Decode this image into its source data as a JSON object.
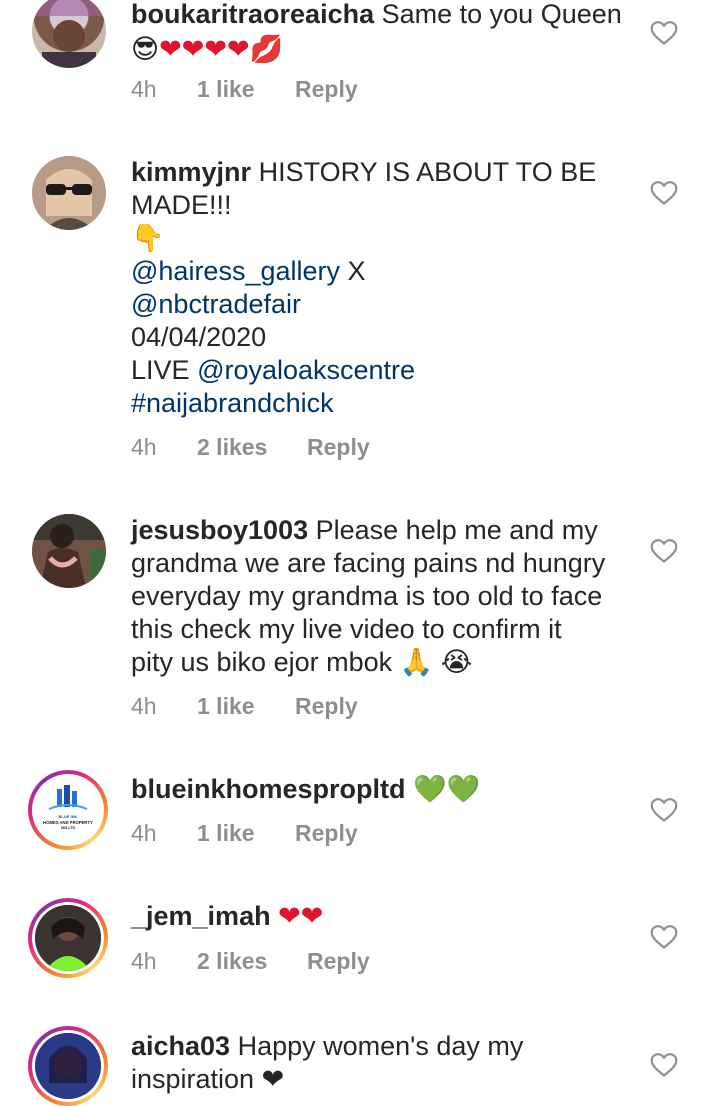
{
  "comments": [
    {
      "username": "boukaritraoreaicha",
      "text": "Same to you Queen",
      "emoji_line": "😎❤❤❤❤💋",
      "time": "4h",
      "likes": "1 like",
      "reply": "Reply"
    },
    {
      "username": "kimmyjnr",
      "lines": [
        "HISTORY IS ABOUT TO BE",
        "MADE!!!",
        "👇"
      ],
      "mention1": "@hairess_gallery",
      "x": "X",
      "mention2": "@nbctradefair",
      "date": "04/04/2020",
      "live": "LIVE",
      "mention3": "@royaloakscentre",
      "hashtag": "#naijabrandchick",
      "time": "4h",
      "likes": "2 likes",
      "reply": "Reply"
    },
    {
      "username": "jesusboy1003",
      "lines": [
        "Please help me and my",
        "grandma we are facing pains nd hungry",
        "everyday my grandma is too old to face",
        "this check my live video to confirm it",
        "pity us biko ejor mbok 🙏 😭"
      ],
      "time": "4h",
      "likes": "1 like",
      "reply": "Reply"
    },
    {
      "username": "blueinkhomespropltd",
      "emoji": "💚💚",
      "avatar_text": "BLUE INK HOMES AND PROPERTY NIG LTD",
      "time": "4h",
      "likes": "1 like",
      "reply": "Reply"
    },
    {
      "username": "_jem_imah",
      "emoji": "❤❤",
      "time": "4h",
      "likes": "2 likes",
      "reply": "Reply"
    },
    {
      "username": "aicha03",
      "lines": [
        "Happy women's day my",
        "inspiration ❤"
      ]
    }
  ],
  "icons": {
    "like": "heart-outline-icon"
  },
  "colors": {
    "mention": "#003569",
    "meta": "#8e8e8e",
    "heart": "#e0152d"
  }
}
